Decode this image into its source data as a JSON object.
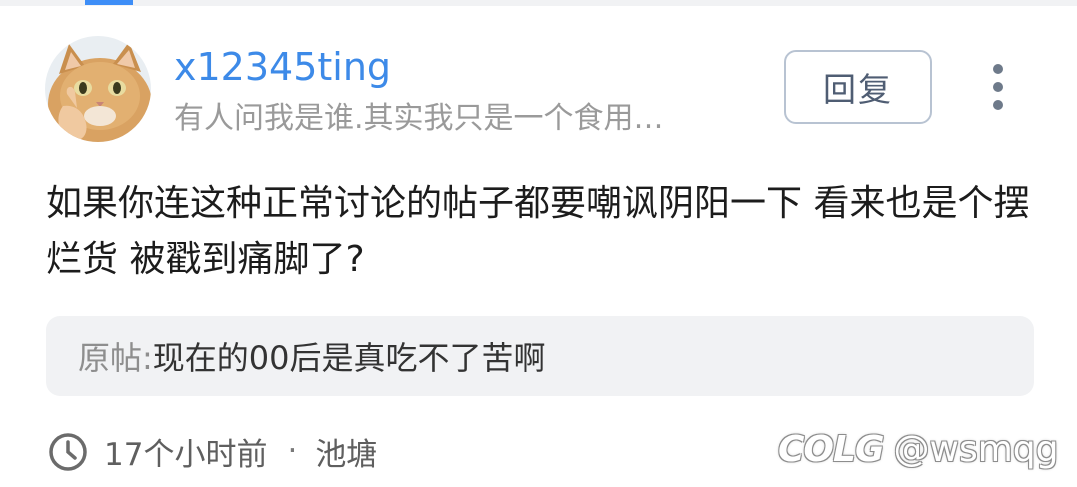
{
  "user": {
    "name": "x12345ting",
    "bio": "有人问我是谁.其实我只是一个食用…"
  },
  "actions": {
    "reply_label": "回复"
  },
  "comment": {
    "text": "如果你连这种正常讨论的帖子都要嘲讽阴阳一下 看来也是个摆烂货 被戳到痛脚了?"
  },
  "quote": {
    "label": "原帖:",
    "text": "现在的00后是真吃不了苦啊"
  },
  "meta": {
    "time": "17个小时前",
    "separator": "·",
    "forum": "池塘"
  },
  "watermark": {
    "logo": "COLG",
    "handle": "@wsmqg"
  },
  "colors": {
    "username": "#3d8ae8",
    "accent_tab": "#3e8ef7",
    "quote_bg": "#f1f2f4"
  }
}
